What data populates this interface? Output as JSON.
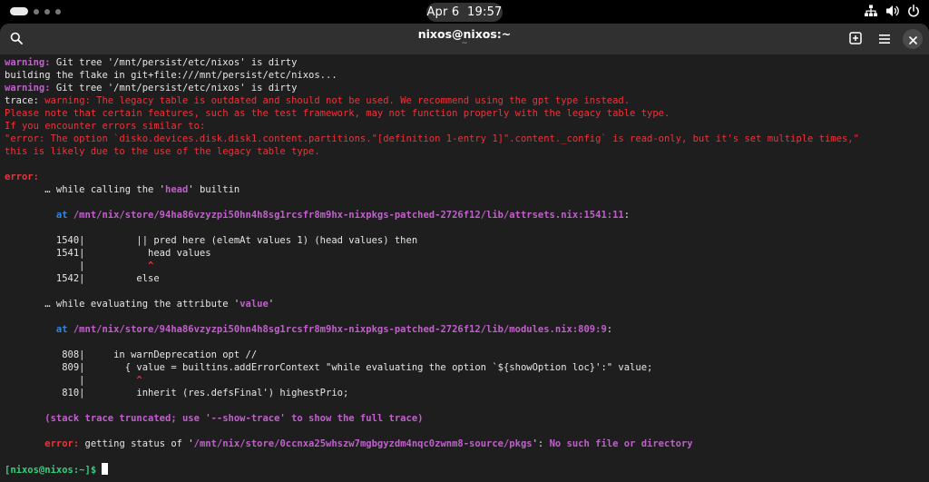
{
  "topbar": {
    "date": "Apr 6",
    "time": "19:57",
    "icons": [
      "activities-indicator",
      "network-wired-icon",
      "volume-icon",
      "power-icon"
    ]
  },
  "window": {
    "title": "nixos@nixos:~",
    "subtitle": "~",
    "icons": [
      "search-icon",
      "new-tab-icon",
      "hamburger-menu-icon",
      "close-icon"
    ]
  },
  "colors": {
    "background": "#1e1e1e",
    "headerbar": "#303030",
    "warning_purple": "#c061cb",
    "error_red": "#ed333b",
    "location_blue": "#3584e4",
    "prompt_green": "#33d17a"
  },
  "terminal": {
    "l1": {
      "a": "warning:",
      "b": " Git tree '/mnt/persist/etc/nixos' is dirty"
    },
    "l2": {
      "a": "building the flake in git+file:///mnt/persist/etc/nixos..."
    },
    "l3": {
      "a": "warning:",
      "b": " Git tree '/mnt/persist/etc/nixos' is dirty"
    },
    "l4": {
      "a": "trace: ",
      "b": "warning: The legacy table is outdated and should not be used. We recommend using the gpt type instead."
    },
    "l5": {
      "a": "Please note that certain features, such as the test framework, may not function properly with the legacy table type."
    },
    "l6": {
      "a": "If you encounter errors similar to:"
    },
    "l7": {
      "a": "\"error: The option `disko.devices.disk.disk1.content.partitions.\"[definition 1-entry 1]\".content._config` is read-only, but it's set multiple times,\""
    },
    "l8": {
      "a": "this is likely due to the use of the legacy table type."
    },
    "l9": {
      "a": "error:"
    },
    "l10": {
      "a": "       … while calling the '",
      "b": "head",
      "c": "' builtin"
    },
    "l11": {
      "a": "         at ",
      "b": "/mnt/nix/store/94ha86vzyzpi50hn4h8sg1rcsfr8m9hx-nixpkgs-patched-2726f12/lib/attrsets.nix:1541:11",
      "c": ":"
    },
    "l12": {
      "a": "         1540|         || pred here (elemAt values 1) (head values) then"
    },
    "l13": {
      "a": "         1541|           head values"
    },
    "l14": {
      "a": "             |",
      "b": "           ^"
    },
    "l15": {
      "a": "         1542|         else"
    },
    "l16": {
      "a": "       … while evaluating the attribute '",
      "b": "value",
      "c": "'"
    },
    "l17": {
      "a": "         at ",
      "b": "/mnt/nix/store/94ha86vzyzpi50hn4h8sg1rcsfr8m9hx-nixpkgs-patched-2726f12/lib/modules.nix:809:9",
      "c": ":"
    },
    "l18": {
      "a": "          808|     in warnDeprecation opt //"
    },
    "l19": {
      "a": "          809|       { value = builtins.addErrorContext \"while evaluating the option `${showOption loc}':\" value;"
    },
    "l20": {
      "a": "             |",
      "b": "         ^"
    },
    "l21": {
      "a": "          810|         inherit (res.defsFinal') highestPrio;"
    },
    "l22": {
      "a": "       (stack trace truncated; use '--show-trace' to show the full trace)"
    },
    "l23": {
      "a": "       error:",
      "b": " getting status of '",
      "c": "/mnt/nix/store/0ccnxa25whszw7mgbgyzdm4nqc0zwnm8-source/pkgs",
      "d": "': ",
      "e": "No such file or directory"
    },
    "l24": {
      "a": "[nixos@nixos:~]$",
      "b": " "
    }
  }
}
